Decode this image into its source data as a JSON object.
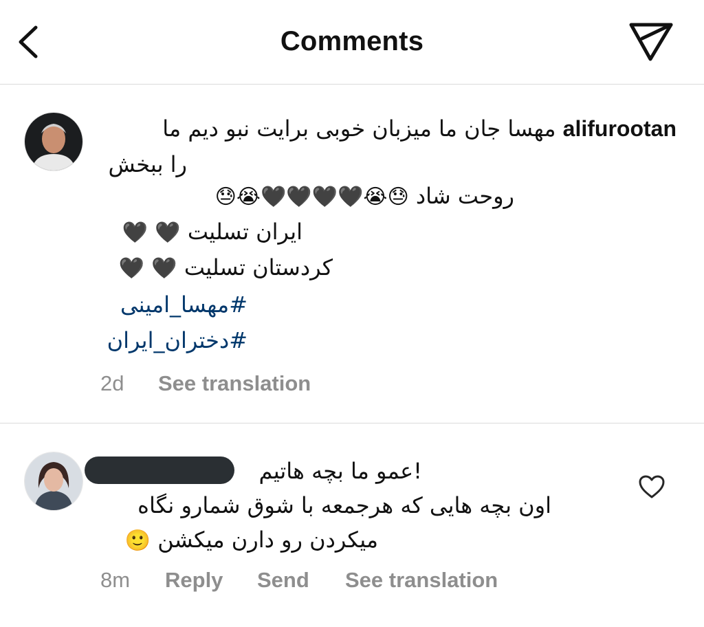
{
  "header": {
    "title": "Comments",
    "back_icon": "chevron-left-icon",
    "share_icon": "paper-plane-icon"
  },
  "comments": [
    {
      "username": "alifurootan",
      "line1_text": "مهسا جان ما میزبان خوبی برایت نبو دیم ما",
      "line2": "را ببخش",
      "line3_text": "روحت شاد",
      "line3_emojis": "😓😭🖤🖤🖤🖤😭😓",
      "line4_text": "ایران تسلیت",
      "line4_emojis": "🖤",
      "line5_text": "کردستان تسلیت",
      "line5_emojis": "🖤",
      "hashtag1": "#مهسا_امینی",
      "hashtag2": "#دختران_ایران",
      "time": "2d",
      "see_translation": "See translation"
    },
    {
      "line1": "!عمو ما بچه هاتیم",
      "line2": "اون بچه هایی که هرجمعه با شوق شمارو نگاه",
      "line3_text": "میکردن رو دارن میکشن",
      "line3_emoji": "🙂",
      "time": "8m",
      "reply": "Reply",
      "send": "Send",
      "see_translation": "See translation",
      "like_icon": "heart-outline-icon"
    }
  ],
  "colors": {
    "hashtag": "#00376b",
    "meta": "#8e8e8e",
    "divider": "#dbdbdb",
    "redaction": "#2a2f33"
  }
}
